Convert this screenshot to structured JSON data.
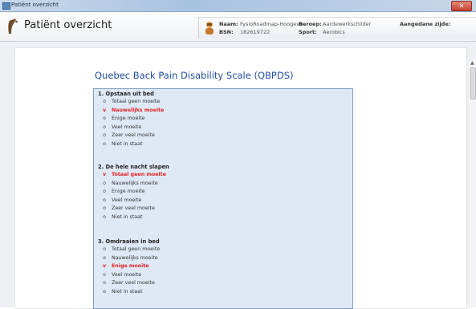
{
  "window": {
    "title": "Patiënt overzicht"
  },
  "header": {
    "page_title": "Patiënt overzicht",
    "patient": {
      "naam_label": "Naam:",
      "naam_value": "FysioRoadmap-Hoogeve",
      "bsn_label": "BSN:",
      "bsn_value": "182619722",
      "beroep_label": "Beroep:",
      "beroep_value": "Aardewerkschilder",
      "sport_label": "Sport:",
      "sport_value": "Aerobics",
      "zijde_label": "Aangedane zijde:"
    }
  },
  "form": {
    "title": "Quebec Back Pain Disability Scale (QBPDS)",
    "questions": [
      {
        "title": "1. Opstaan uit bed",
        "options": [
          {
            "mark": "o",
            "label": "Totaal geen moeite",
            "selected": false
          },
          {
            "mark": "v",
            "label": "Nauwelijks moeite",
            "selected": true
          },
          {
            "mark": "o",
            "label": "Enige moeite",
            "selected": false
          },
          {
            "mark": "o",
            "label": "Veel moeite",
            "selected": false
          },
          {
            "mark": "o",
            "label": "Zeer veel moeite",
            "selected": false
          },
          {
            "mark": "o",
            "label": "Niet in staat",
            "selected": false
          }
        ]
      },
      {
        "title": "2. De hele nacht slapen",
        "options": [
          {
            "mark": "v",
            "label": "Totaal geen moeite",
            "selected": true
          },
          {
            "mark": "o",
            "label": "Nauwelijks moeite",
            "selected": false
          },
          {
            "mark": "o",
            "label": "Enige moeite",
            "selected": false
          },
          {
            "mark": "o",
            "label": "Veel moeite",
            "selected": false
          },
          {
            "mark": "o",
            "label": "Zeer veel moeite",
            "selected": false
          },
          {
            "mark": "o",
            "label": "Niet in staat",
            "selected": false
          }
        ]
      },
      {
        "title": "3. Omdraaien in bed",
        "options": [
          {
            "mark": "o",
            "label": "Totaal geen moeite",
            "selected": false
          },
          {
            "mark": "o",
            "label": "Nauwelijks moeite",
            "selected": false
          },
          {
            "mark": "v",
            "label": "Enige moeite",
            "selected": true
          },
          {
            "mark": "o",
            "label": "Veel moeite",
            "selected": false
          },
          {
            "mark": "o",
            "label": "Zeer veel moeite",
            "selected": false
          },
          {
            "mark": "o",
            "label": "Niet in staat",
            "selected": false
          }
        ]
      }
    ]
  },
  "colors": {
    "selected": "#e02020",
    "form_title": "#1f4ea3",
    "form_background": "#dfe9f6",
    "form_border": "#7e9ec4"
  },
  "icons": {
    "window": "app-window-icon",
    "header": "footprint-icon",
    "patient": "patient-avatar-icon",
    "close": "close-icon"
  }
}
